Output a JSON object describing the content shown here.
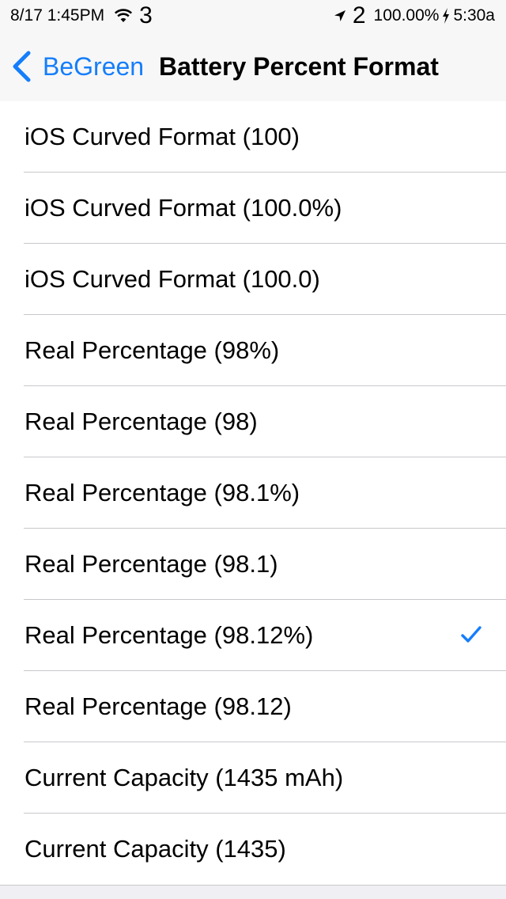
{
  "status_bar": {
    "datetime": "8/17 1:45PM",
    "left_number": "3",
    "right_number": "2",
    "battery_percent": "100.00%",
    "time": "5:30a",
    "icons": [
      "wifi-icon",
      "location-arrow-icon",
      "charging-bolt-icon"
    ]
  },
  "nav": {
    "back_label": "BeGreen",
    "title": "Battery Percent Format",
    "back_icon": "chevron-left-icon"
  },
  "options": [
    {
      "label": "iOS Curved Format (100)",
      "selected": false
    },
    {
      "label": "iOS Curved Format (100.0%)",
      "selected": false
    },
    {
      "label": "iOS Curved Format (100.0)",
      "selected": false
    },
    {
      "label": "Real Percentage (98%)",
      "selected": false
    },
    {
      "label": "Real Percentage (98)",
      "selected": false
    },
    {
      "label": "Real Percentage (98.1%)",
      "selected": false
    },
    {
      "label": "Real Percentage (98.1)",
      "selected": false
    },
    {
      "label": "Real Percentage (98.12%)",
      "selected": true
    },
    {
      "label": "Real Percentage (98.12)",
      "selected": false
    },
    {
      "label": "Current Capacity (1435 mAh)",
      "selected": false
    },
    {
      "label": "Current Capacity (1435)",
      "selected": false
    }
  ],
  "colors": {
    "accent": "#157efb",
    "background": "#efeff4",
    "separator": "#c8c7cc"
  }
}
